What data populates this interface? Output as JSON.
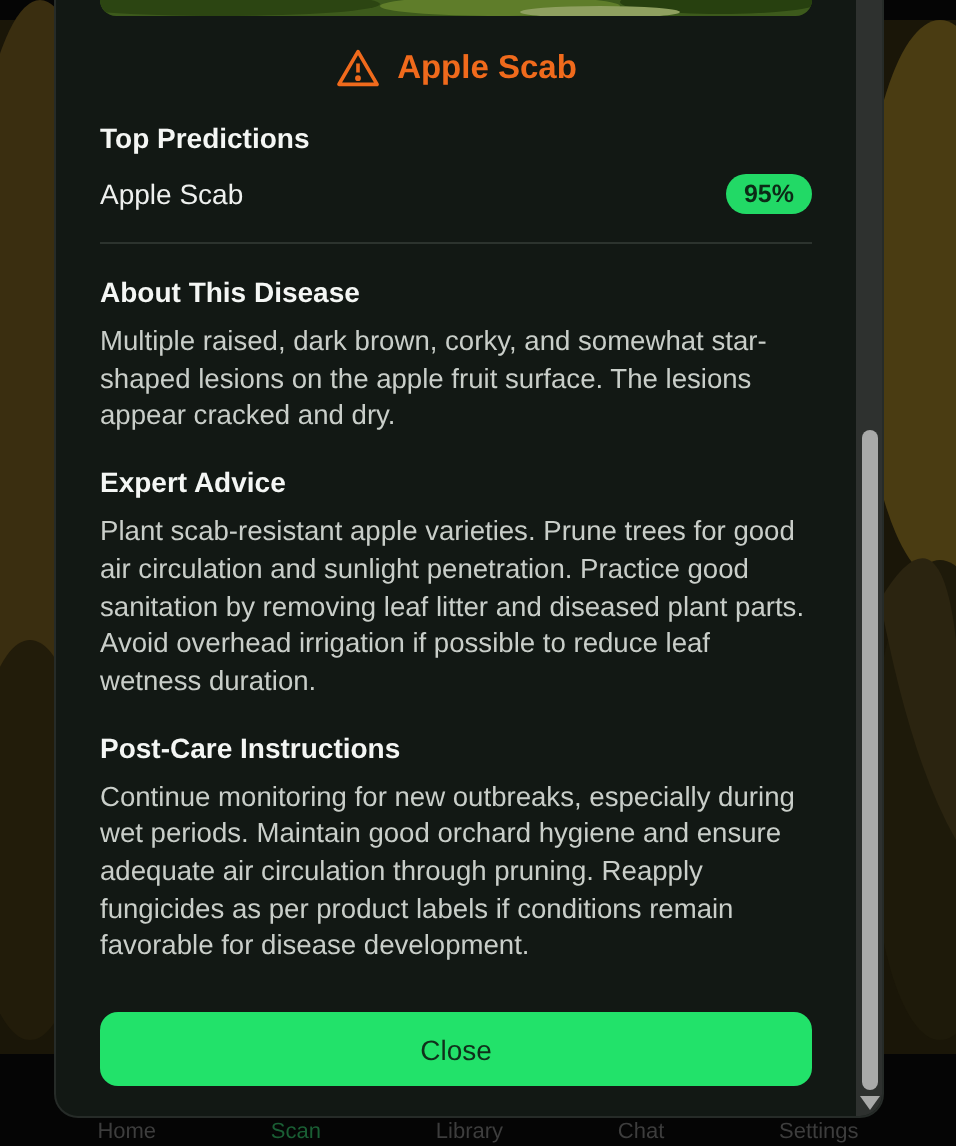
{
  "result": {
    "title": "Apple Scab",
    "predictions_heading": "Top Predictions",
    "predictions": [
      {
        "name": "Apple Scab",
        "confidence": "95%"
      }
    ],
    "sections": [
      {
        "heading": "About This Disease",
        "text": "Multiple raised, dark brown, corky, and somewhat star-shaped lesions on the apple fruit surface. The lesions appear cracked and dry."
      },
      {
        "heading": "Expert Advice",
        "text": "Plant scab-resistant apple varieties. Prune trees for good air circulation and sunlight penetration. Practice good sanitation by removing leaf litter and diseased plant parts. Avoid overhead irrigation if possible to reduce leaf wetness duration."
      },
      {
        "heading": "Post-Care Instructions",
        "text": "Continue monitoring for new outbreaks, especially during wet periods. Maintain good orchard hygiene and ensure adequate air circulation through pruning. Reapply fungicides as per product labels if conditions remain favorable for disease development."
      }
    ],
    "close_button": "Close"
  },
  "nav": [
    {
      "label": "Home",
      "selected": false
    },
    {
      "label": "Scan",
      "selected": true
    },
    {
      "label": "Library",
      "selected": false
    },
    {
      "label": "Chat",
      "selected": false
    },
    {
      "label": "Settings",
      "selected": false
    }
  ]
}
